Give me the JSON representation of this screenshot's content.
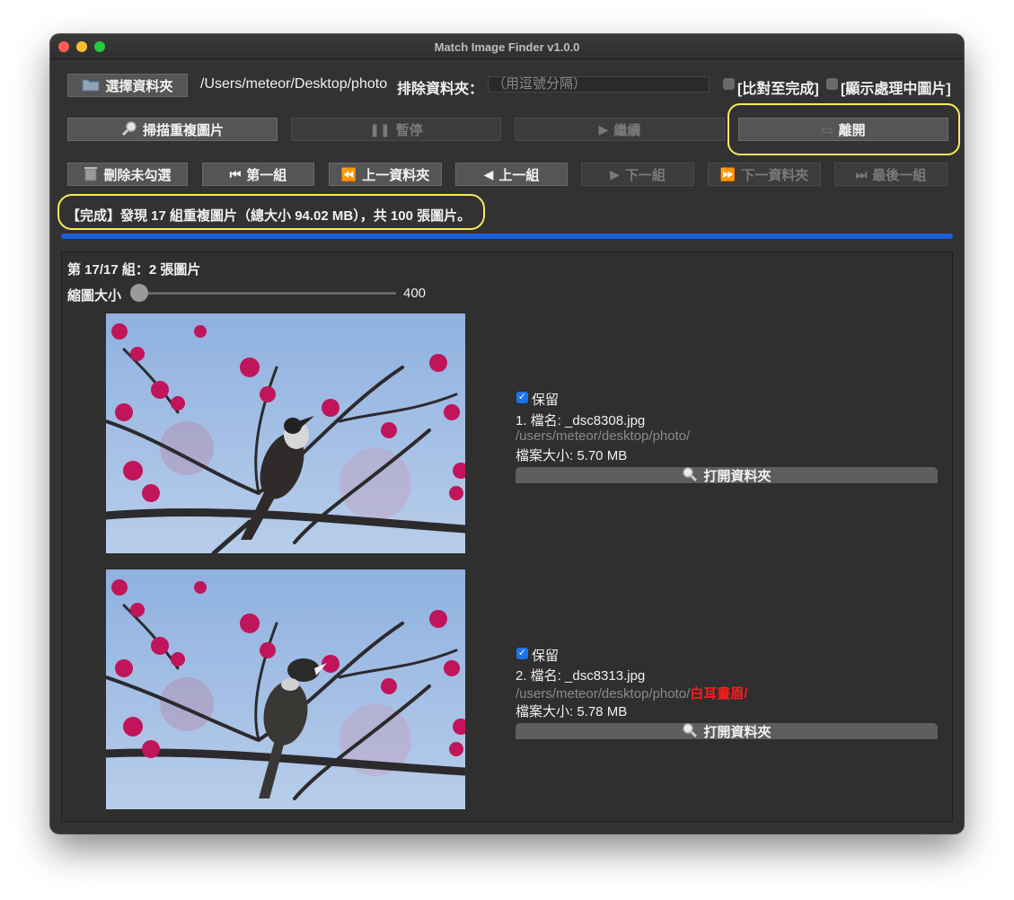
{
  "window": {
    "title": "Match Image Finder v1.0.0"
  },
  "toolbar": {
    "select_folder": "選擇資料夾",
    "folder_path": "/Users/meteor/Desktop/photo",
    "exclude_label": "排除資料夾：",
    "exclude_placeholder": "（用逗號分隔）",
    "compare_to_end": "[比對至完成]",
    "show_processing": "[顯示處理中圖片]",
    "scan": "掃描重複圖片",
    "pause": "暫停",
    "resume": "繼續",
    "leave": "離開",
    "delete_unchecked": "刪除未勾選",
    "first_group": "第一組",
    "prev_folder": "上一資料夾",
    "prev_group": "上一組",
    "next_group": "下一組",
    "next_folder": "下一資料夾",
    "last_group": "最後一組"
  },
  "status": {
    "text": "【完成】發現 17 組重複圖片（總大小 94.02 MB），共 100 張圖片。"
  },
  "group": {
    "header": "第 17/17 組：2 張圖片",
    "thumb_label": "縮圖大小",
    "thumb_value": "400",
    "thumb_level": 0.0
  },
  "items": [
    {
      "keep_label": "保留",
      "keep_checked": true,
      "name": "1. 檔名: _dsc8308.jpg",
      "path": "/users/meteor/desktop/photo/",
      "path_extra": "",
      "size": "檔案大小: 5.70 MB",
      "open_label": "打開資料夾"
    },
    {
      "keep_label": "保留",
      "keep_checked": true,
      "name": "2. 檔名: _dsc8313.jpg",
      "path": "/users/meteor/desktop/photo/",
      "path_extra": "白耳畫眉/",
      "size": "檔案大小: 5.78 MB",
      "open_label": "打開資料夾"
    }
  ],
  "colors": {
    "window_bg": "#323232",
    "accent_blue": "#1a5fd8",
    "highlight_yellow": "#f4ea5a",
    "warning_red": "#ff1a1a"
  },
  "icons": [
    "folder-icon",
    "magnifier-icon",
    "pause-icon",
    "play-icon",
    "exit-icon",
    "trash-icon",
    "skip-first-icon",
    "rewind-icon",
    "prev-icon",
    "next-icon",
    "fast-forward-icon",
    "skip-last-icon"
  ]
}
